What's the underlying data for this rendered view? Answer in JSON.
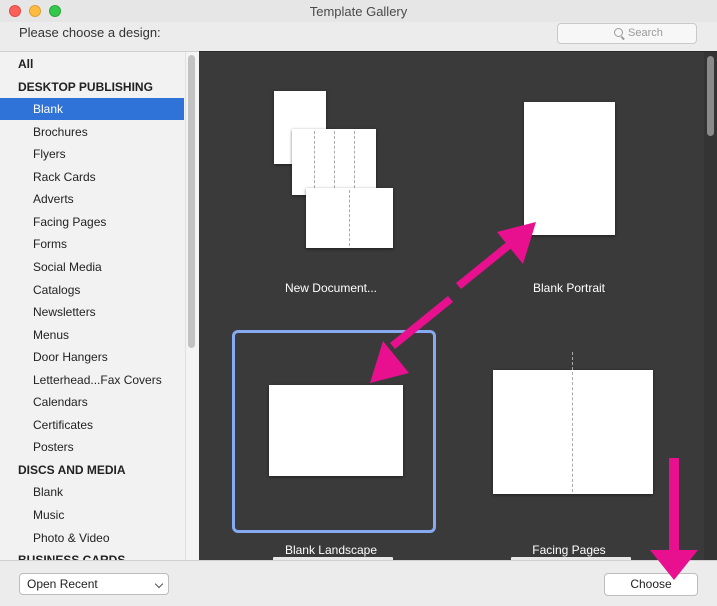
{
  "window": {
    "title": "Template Gallery"
  },
  "header": {
    "prompt": "Please choose a design:",
    "search_placeholder": "Search"
  },
  "sidebar": {
    "rows": [
      {
        "label": "All",
        "kind": "head"
      },
      {
        "label": "DESKTOP PUBLISHING",
        "kind": "head"
      },
      {
        "label": "Blank",
        "kind": "item",
        "selected": true
      },
      {
        "label": "Brochures",
        "kind": "item"
      },
      {
        "label": "Flyers",
        "kind": "item"
      },
      {
        "label": "Rack Cards",
        "kind": "item"
      },
      {
        "label": "Adverts",
        "kind": "item"
      },
      {
        "label": "Facing Pages",
        "kind": "item"
      },
      {
        "label": "Forms",
        "kind": "item"
      },
      {
        "label": "Social Media",
        "kind": "item"
      },
      {
        "label": "Catalogs",
        "kind": "item"
      },
      {
        "label": "Newsletters",
        "kind": "item"
      },
      {
        "label": "Menus",
        "kind": "item"
      },
      {
        "label": "Door Hangers",
        "kind": "item"
      },
      {
        "label": "Letterhead...Fax Covers",
        "kind": "item"
      },
      {
        "label": "Calendars",
        "kind": "item"
      },
      {
        "label": "Certificates",
        "kind": "item"
      },
      {
        "label": "Posters",
        "kind": "item"
      },
      {
        "label": "DISCS AND MEDIA",
        "kind": "head"
      },
      {
        "label": "Blank",
        "kind": "item"
      },
      {
        "label": "Music",
        "kind": "item"
      },
      {
        "label": "Photo & Video",
        "kind": "item"
      },
      {
        "label": "BUSINESS CARDS",
        "kind": "head"
      }
    ]
  },
  "templates": [
    {
      "label": "New Document..."
    },
    {
      "label": "Blank Portrait"
    },
    {
      "label": "Blank Landscape",
      "selected": true
    },
    {
      "label": "Facing Pages"
    }
  ],
  "footer": {
    "open_recent": "Open Recent",
    "choose": "Choose"
  },
  "colors": {
    "selection": "#2f72d8",
    "gallery_bg": "#3a3a3a",
    "highlight_border": "#86a9f2",
    "annotation_arrow": "#e8108f"
  }
}
